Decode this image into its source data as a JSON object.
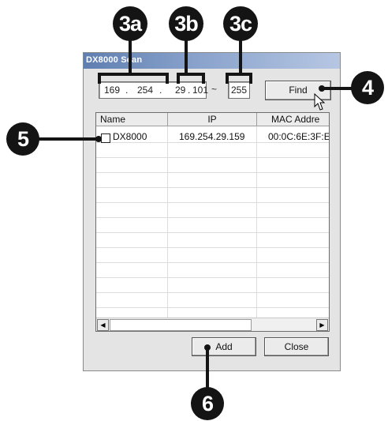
{
  "window": {
    "title": "DX8000 Scan"
  },
  "scan": {
    "ip_start": {
      "seg1": "169",
      "seg2": "254",
      "seg3": "29",
      "seg4": "101"
    },
    "range_separator": "~",
    "ip_end": "255",
    "find_label": "Find"
  },
  "list": {
    "columns": [
      "Name",
      "IP",
      "MAC Addre"
    ],
    "rows": [
      {
        "name": "DX8000",
        "ip": "169.254.29.159",
        "mac": "00:0C:6E:3F:E"
      }
    ]
  },
  "buttons": {
    "add_label": "Add",
    "close_label": "Close"
  },
  "callouts": {
    "c3a": "3a",
    "c3b": "3b",
    "c3c": "3c",
    "c4": "4",
    "c5": "5",
    "c6": "6"
  }
}
